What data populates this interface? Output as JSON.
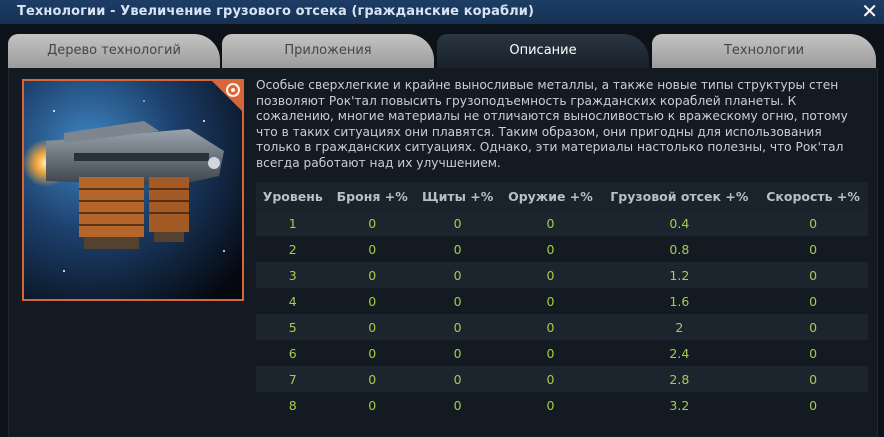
{
  "window": {
    "title": "Технологии - Увеличение грузового отсека (гражданские корабли)",
    "close_icon": "close-icon"
  },
  "tabs": [
    {
      "label": "Дерево технологий",
      "active": false
    },
    {
      "label": "Приложения",
      "active": false
    },
    {
      "label": "Описание",
      "active": true
    },
    {
      "label": "Технологии",
      "active": false
    }
  ],
  "content": {
    "image_icon": "cargo-ship-icon",
    "badge_icon": "gear-badge-icon",
    "description": "Особые сверхлегкие и крайне выносливые металлы, а также новые типы структуры стен позволяют Рок'тал повысить грузоподъемность гражданских кораблей планеты. К сожалению, многие материалы не отличаются выносливостью к вражескому огню, потому что в таких ситуациях они плавятся. Таким образом, они пригодны для использования только в гражданских ситуациях. Однако, эти материалы настолько полезны, что Рок'тал всегда работают над их улучшением."
  },
  "table": {
    "columns": [
      "Уровень",
      "Броня +%",
      "Щиты +%",
      "Оружие +%",
      "Грузовой отсек +%",
      "Скорость +%"
    ],
    "rows": [
      [
        "1",
        "0",
        "0",
        "0",
        "0.4",
        "0"
      ],
      [
        "2",
        "0",
        "0",
        "0",
        "0.8",
        "0"
      ],
      [
        "3",
        "0",
        "0",
        "0",
        "1.2",
        "0"
      ],
      [
        "4",
        "0",
        "0",
        "0",
        "1.6",
        "0"
      ],
      [
        "5",
        "0",
        "0",
        "0",
        "2",
        "0"
      ],
      [
        "6",
        "0",
        "0",
        "0",
        "2.4",
        "0"
      ],
      [
        "7",
        "0",
        "0",
        "0",
        "2.8",
        "0"
      ],
      [
        "8",
        "0",
        "0",
        "0",
        "3.2",
        "0"
      ]
    ]
  },
  "colors": {
    "accent_orange": "#d9663a",
    "value_green": "#9ed04b",
    "title_bar": "#1d3d66"
  }
}
